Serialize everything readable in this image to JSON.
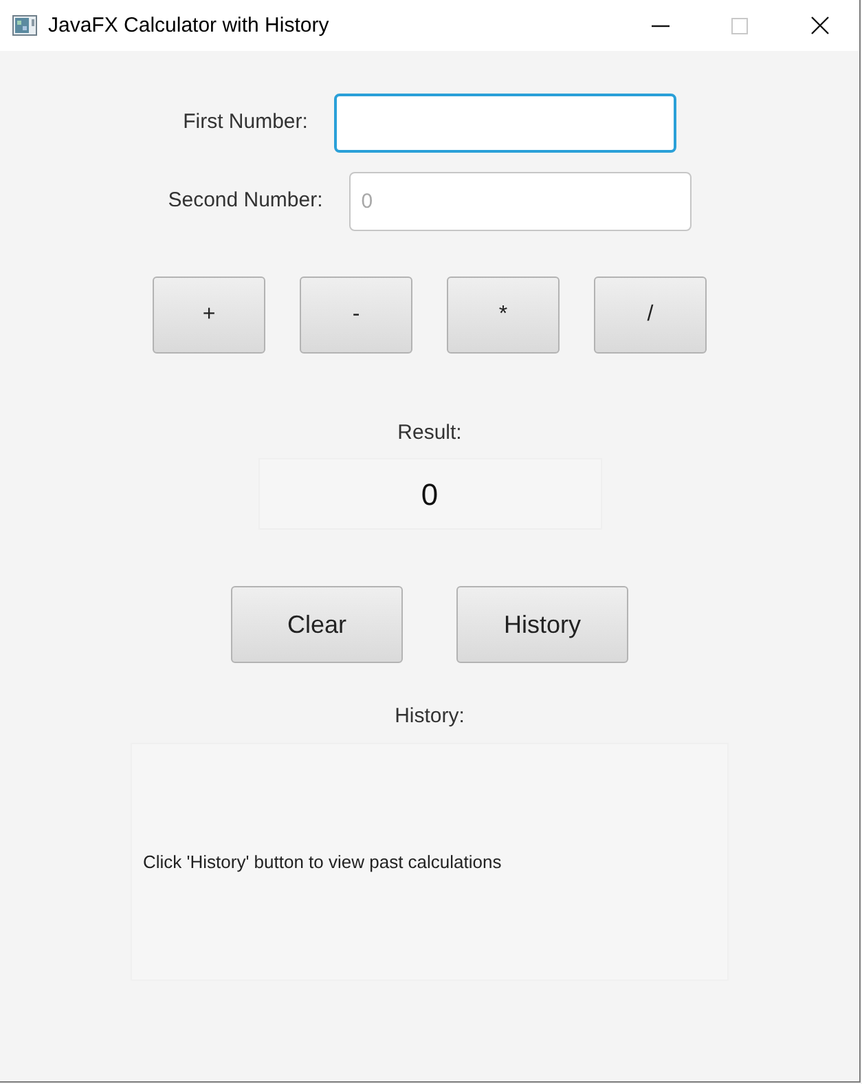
{
  "window": {
    "title": "JavaFX Calculator with History",
    "controls": [
      {
        "kind": "minimize",
        "disabled": false
      },
      {
        "kind": "maximize",
        "disabled": true
      },
      {
        "kind": "close",
        "disabled": false
      }
    ]
  },
  "fields": [
    {
      "label": "First Number:",
      "focused": true
    },
    {
      "label": "Second Number:",
      "placeholder": "0",
      "focused": false
    }
  ],
  "operators": [
    "+",
    "-",
    "*",
    "/"
  ],
  "result": {
    "label": "Result:",
    "value": "0"
  },
  "actions": [
    "Clear",
    "History"
  ],
  "history": {
    "label": "History:",
    "message": "Click 'History' button to view past calculations"
  }
}
